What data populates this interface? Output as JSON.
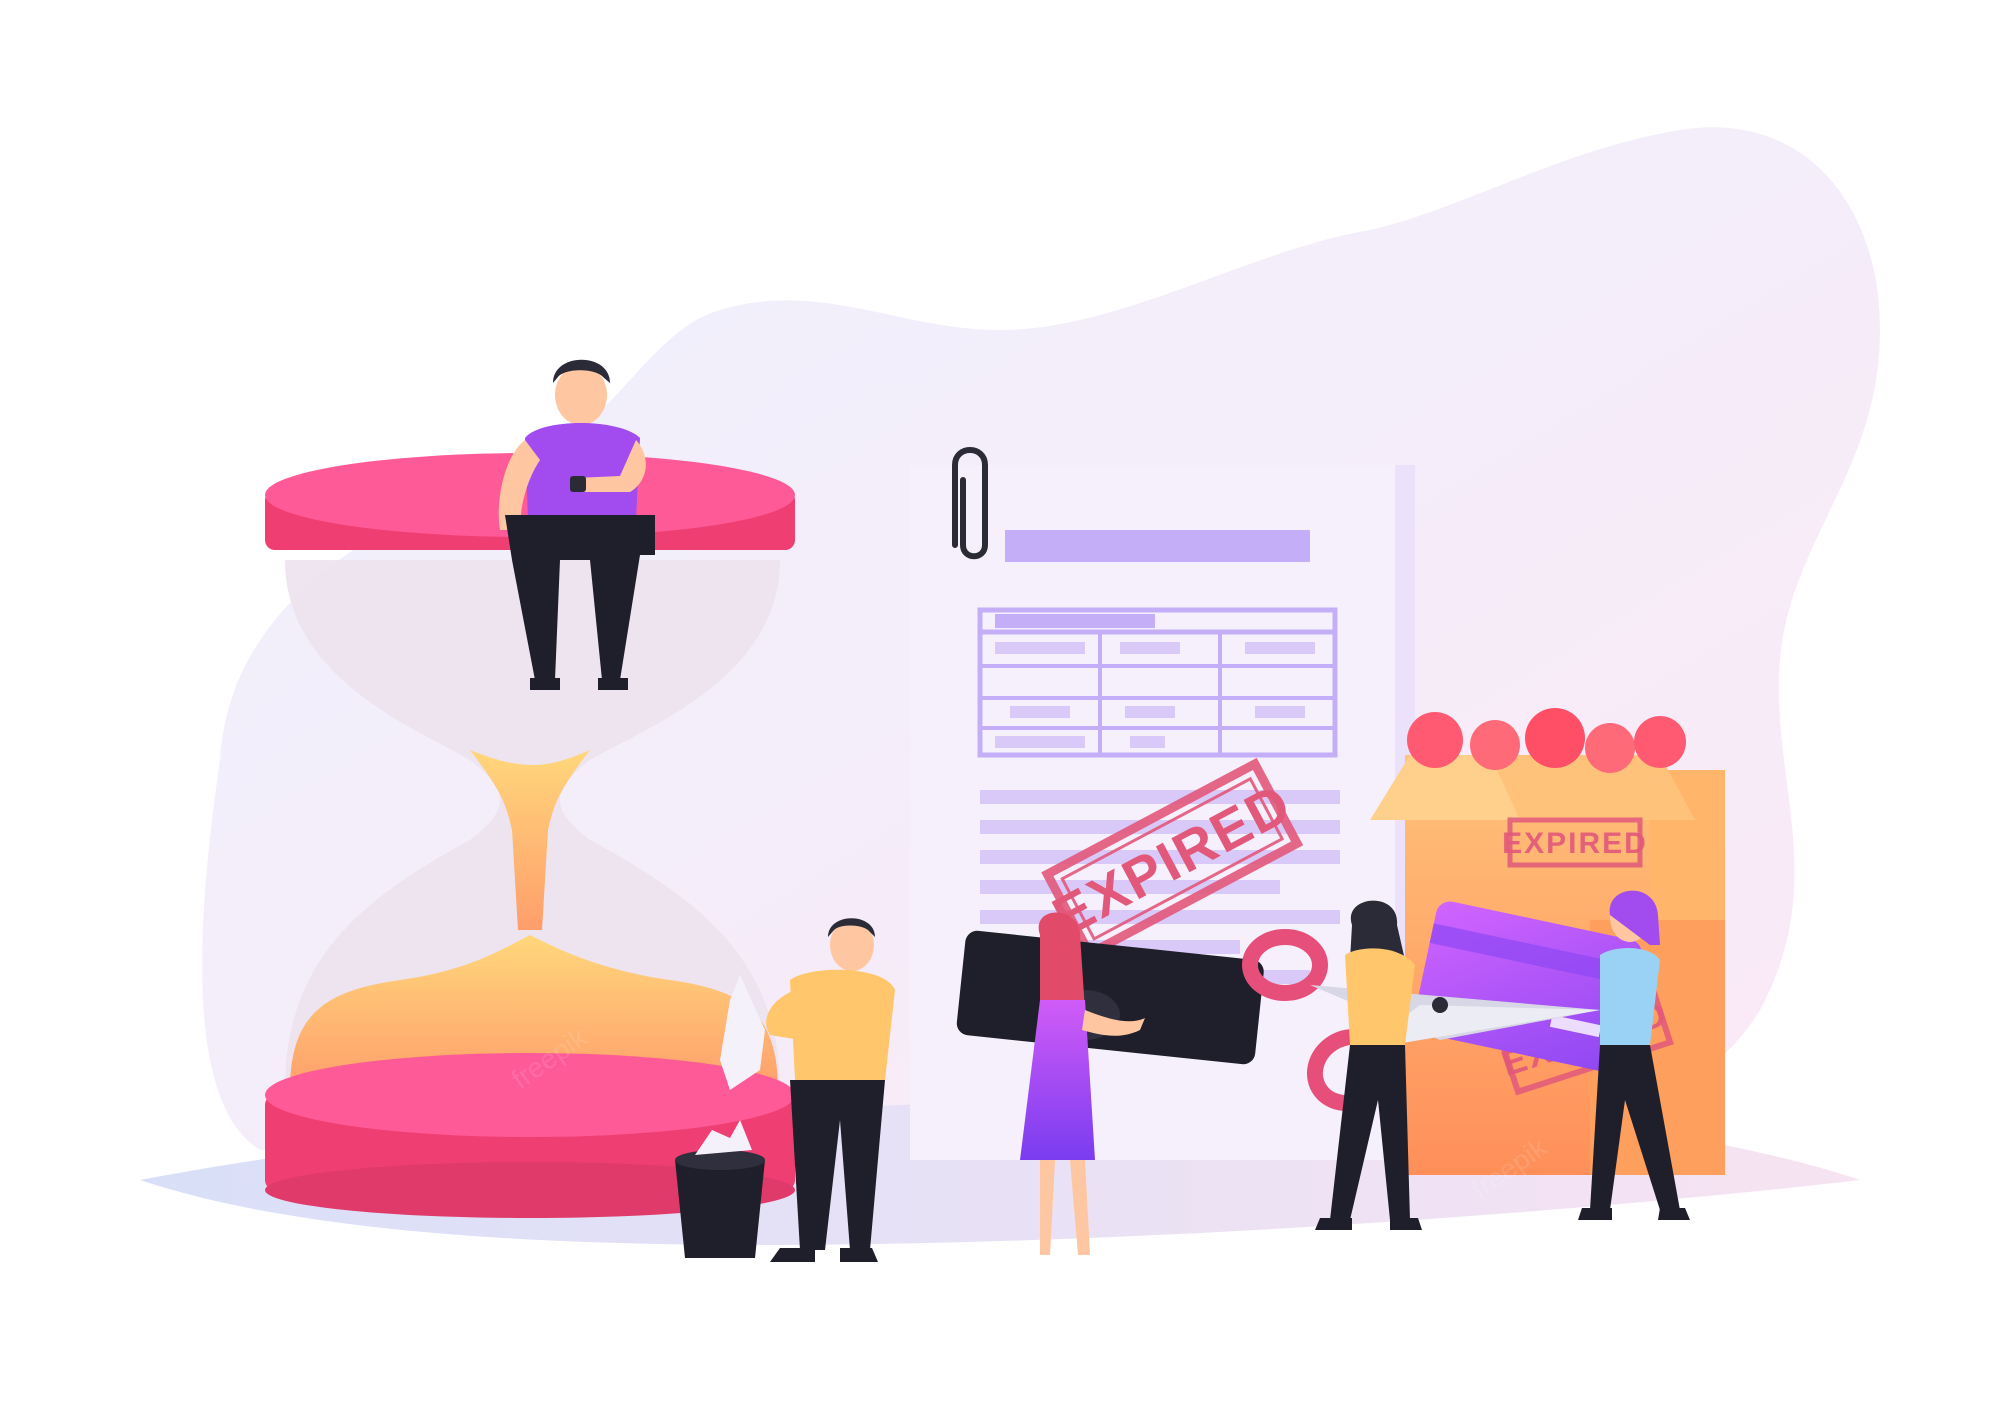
{
  "scene": {
    "colors": {
      "background": "#ffffff",
      "blob": "#f3ecfb",
      "floor": "#dfe1f7",
      "hourglass_cap": "#f04f86",
      "hourglass_cap_top": "#ff6ba3",
      "hourglass_glass": "#ede2ee",
      "sand": "#ffcf77",
      "sand_bottom": "#ffb56b",
      "document": "#f6f0fd",
      "document_lines": "#c9b6f7",
      "stamp": "#e2587a",
      "box": "#ffb56a",
      "box_dark": "#ff9f5d",
      "card": "#b45bf0",
      "skin": "#ffc7a1",
      "shirt_yellow": "#ffc66b",
      "shirt_purple": "#a24cf0",
      "pants": "#1f1f2b",
      "dress": "#b056f5",
      "ball": "#ff5a72",
      "scissors": "#e64f79",
      "trash": "#1f1f2b"
    },
    "icons": {
      "hourglass": "hourglass-icon",
      "document": "document-icon",
      "paperclip": "paperclip-icon",
      "box": "box-icon",
      "credit_card": "credit-card-icon",
      "scissors": "scissors-icon",
      "trash": "trash-bin-icon"
    }
  },
  "stamps": {
    "document_stamp": "EXPIRED",
    "box_top_stamp": "EXPIRED",
    "box_bottom_stamp": "EXPIRED"
  },
  "watermark": {
    "text": "freepik"
  }
}
